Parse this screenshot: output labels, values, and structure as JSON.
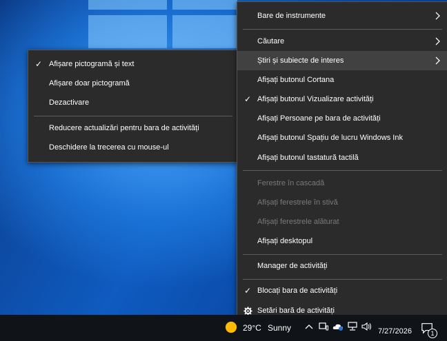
{
  "news_submenu": {
    "items": [
      {
        "label": "Afișare pictogramă și text",
        "checked": true
      },
      {
        "label": "Afișare doar pictogramă",
        "checked": false
      },
      {
        "label": "Dezactivare",
        "checked": false
      },
      {
        "label": "Reducere actualizări pentru bara de activități",
        "checked": false
      },
      {
        "label": "Deschidere la trecerea cu mouse-ul",
        "checked": false
      }
    ]
  },
  "taskbar_menu": {
    "toolbars": "Bare de instrumente",
    "search": "Căutare",
    "news": "Știri și subiecte de interes",
    "cortana": "Afișați butonul Cortana",
    "task_view": "Afișați butonul Vizualizare activități",
    "people": "Afișați Persoane pe bara de activități",
    "ink": "Afișați butonul Spațiu de lucru Windows Ink",
    "touch_keyboard": "Afișați butonul tastatură tactilă",
    "cascade": "Ferestre în cascadă",
    "stacked": "Afișați ferestrele în stivă",
    "side_by_side": "Afișați ferestrele alăturat",
    "desktop": "Afișați desktopul",
    "task_manager": "Manager de activități",
    "lock_taskbar": "Blocați bara de activități",
    "settings": "Setări bară de activități"
  },
  "taskbar": {
    "weather_temp": "29°C",
    "weather_cond": "Sunny",
    "date": "7/27/2026",
    "notification_count": "1"
  },
  "colors": {
    "menu_bg": "#2b2b2b",
    "highlight": "#414141",
    "disabled_text": "#7a7a7a",
    "sun": "#ffb900"
  }
}
